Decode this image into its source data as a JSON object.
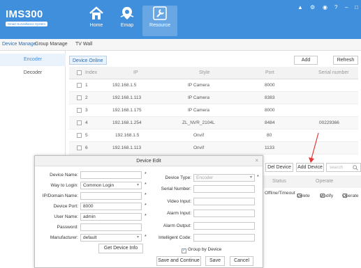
{
  "header": {
    "app_title": "IMS300",
    "app_subtitle": "Smart Surveillance System",
    "nav": [
      {
        "label": "Home",
        "icon": "home-icon"
      },
      {
        "label": "Emap",
        "icon": "map-pin-icon"
      },
      {
        "label": "Resource",
        "icon": "wrench-icon"
      }
    ],
    "window_controls": [
      "shirt-icon",
      "settings-icon",
      "lock-icon",
      "help-icon",
      "minimize-icon",
      "maximize-icon"
    ],
    "accent": "#3f8fdd"
  },
  "subnav": {
    "items": [
      "Device Manage",
      "Group Manage",
      "TV Wall"
    ],
    "active": 0
  },
  "sidebar": {
    "items": [
      "Encoder",
      "Decoder"
    ],
    "active": 0
  },
  "main": {
    "tab_label": "Device Online",
    "add_label": "Add",
    "refresh_label": "Refresh",
    "columns": [
      "Index",
      "IP",
      "Style",
      "Port",
      "Serial number"
    ],
    "rows": [
      {
        "index": "1",
        "ip": "192.168.1.5",
        "style": "IP Camera",
        "port": "8000",
        "serial": ""
      },
      {
        "index": "2",
        "ip": "192.168.1.113",
        "style": "IP Camera",
        "port": "8383",
        "serial": ""
      },
      {
        "index": "3",
        "ip": "192.168.1.175",
        "style": "IP Camera",
        "port": "8000",
        "serial": ""
      },
      {
        "index": "4",
        "ip": "192.168.1.254",
        "style": "ZL_NVR_2104L",
        "port": "8484",
        "serial": "00229366"
      },
      {
        "index": "5",
        "ip": "192.168.1.5",
        "style": "Onvif",
        "port": "80",
        "serial": ""
      },
      {
        "index": "6",
        "ip": "192.168.1.113",
        "style": "Onvif",
        "port": "1133",
        "serial": ""
      }
    ]
  },
  "lower": {
    "del_device": "Del Device",
    "add_device": "Add Device",
    "search_placeholder": "search",
    "columns": [
      "Status",
      "Operate"
    ],
    "row": {
      "status": "Offline/Timeout",
      "delete": "Delete",
      "modify": "Modify",
      "operate": "Operate"
    }
  },
  "dialog": {
    "title": "Device Edit",
    "left": [
      {
        "label": "Device Name:",
        "value": "",
        "required": true,
        "type": "text"
      },
      {
        "label": "Way to Login:",
        "value": "Common Login",
        "required": true,
        "type": "select"
      },
      {
        "label": "IP/Domain Name:",
        "value": "",
        "required": true,
        "type": "text"
      },
      {
        "label": "Device Port:",
        "value": "8000",
        "required": true,
        "type": "text"
      },
      {
        "label": "User Name:",
        "value": "admin",
        "required": true,
        "type": "text"
      },
      {
        "label": "Password:",
        "value": "",
        "required": false,
        "type": "text"
      },
      {
        "label": "Manufacturer:",
        "value": "default",
        "required": true,
        "type": "select"
      }
    ],
    "right": [
      {
        "label": "Device Type:",
        "value": "Encoder",
        "required": true,
        "type": "select"
      },
      {
        "label": "Serial Number:",
        "value": "",
        "required": false,
        "type": "text"
      },
      {
        "label": "Video Input:",
        "value": "",
        "required": false,
        "type": "text"
      },
      {
        "label": "Alarm Input:",
        "value": "",
        "required": false,
        "type": "text"
      },
      {
        "label": "Alarm Output:",
        "value": "",
        "required": false,
        "type": "text"
      },
      {
        "label": "Intelligent Code:",
        "value": "",
        "required": false,
        "type": "text"
      }
    ],
    "get_info_label": "Get Device Info",
    "group_by_label": "Group by Device",
    "group_by_checked": true,
    "save_continue_label": "Save and Continue",
    "save_label": "Save",
    "cancel_label": "Cancel"
  }
}
